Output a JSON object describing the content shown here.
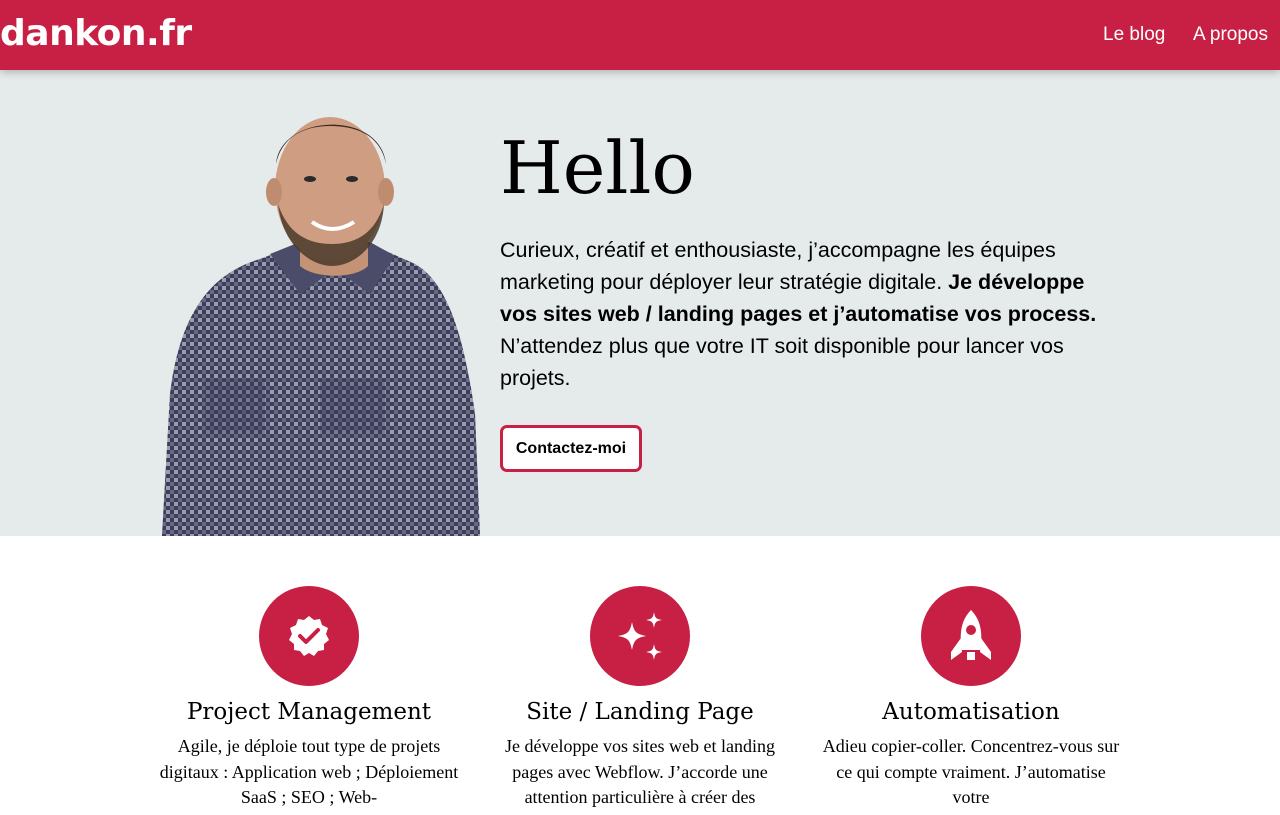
{
  "header": {
    "logo": "dankon.fr",
    "nav": [
      {
        "label": "Le blog"
      },
      {
        "label": "A propos"
      }
    ]
  },
  "hero": {
    "title": "Hello",
    "intro_start": "Curieux, créatif et enthousiaste, j’accompagne les équipes marketing pour déployer leur stratégie digitale. ",
    "intro_bold": "Je développe vos sites web / landing pages et j’automatise vos process.",
    "intro_end": " N’attendez plus que votre IT soit disponible pour lancer vos projets.",
    "cta_label": "Contactez-moi"
  },
  "services": [
    {
      "icon": "verified-badge-icon",
      "title": "Project Management",
      "text": "Agile, je déploie tout type de projets digitaux : Application web ; Déploiement SaaS ; SEO ; Web-"
    },
    {
      "icon": "sparkles-icon",
      "title": "Site / Landing Page",
      "text": "Je développe vos sites web et landing pages avec Webflow. J’accorde une attention particulière à créer des"
    },
    {
      "icon": "rocket-icon",
      "title": "Automatisation",
      "text": "Adieu copier-coller. Concentrez-vous sur ce qui compte vraiment. J’automatise votre"
    }
  ],
  "colors": {
    "brand": "#c82044",
    "hero_bg": "#e5ebeb"
  }
}
